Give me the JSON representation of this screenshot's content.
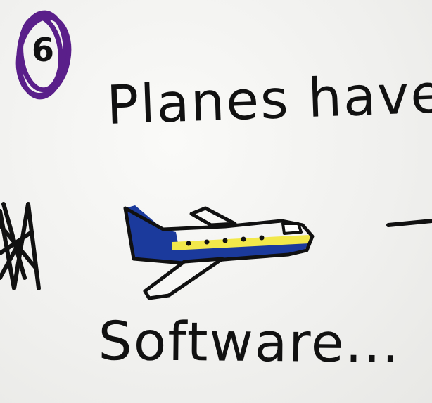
{
  "card": {
    "step_number": "6",
    "headline": "Planes have",
    "subline": "Software..."
  },
  "colors": {
    "ink": "#111111",
    "marker_purple": "#5a1f8a",
    "plane_blue": "#1b3a9c",
    "plane_yellow": "#f2e84a",
    "paper": "#f4f4f2"
  },
  "icons": {
    "plane": "airplane-icon",
    "badge": "number-circle-icon",
    "scribble": "scribble-icon",
    "arrow": "dash-line-icon"
  }
}
